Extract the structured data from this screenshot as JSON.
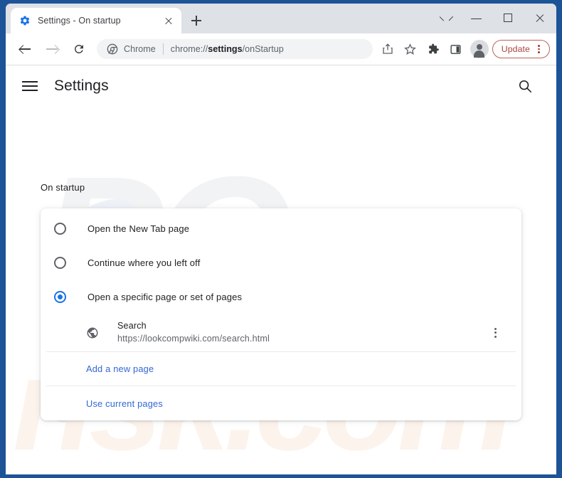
{
  "window": {
    "frame_color": "#1d5397",
    "controls": {
      "tab_search": "tab-search",
      "minimize": "minimize",
      "maximize": "maximize",
      "close": "close"
    }
  },
  "tabstrip": {
    "tabs": [
      {
        "title": "Settings - On startup",
        "favicon": "gear-icon",
        "active": true
      }
    ],
    "new_tab_label": "+"
  },
  "toolbar": {
    "back": "back",
    "forward": "forward",
    "reload": "reload",
    "omnibox": {
      "chip_icon": "chrome-logo-icon",
      "chip_label": "Chrome",
      "url_prefix": "chrome://",
      "url_bold": "settings",
      "url_suffix": "/onStartup",
      "url_full": "chrome://settings/onStartup"
    },
    "icons": [
      "share-icon",
      "bookmark-star-icon",
      "extensions-puzzle-icon",
      "side-panel-icon"
    ],
    "avatar": "profile-avatar",
    "update_label": "Update",
    "update_color": "#a8453c",
    "update_menu": "three-dot-menu"
  },
  "settings": {
    "header": {
      "menu_icon": "hamburger-icon",
      "title": "Settings",
      "search_icon": "search-icon"
    },
    "section_heading": "On startup",
    "options": [
      {
        "label": "Open the New Tab page",
        "selected": false
      },
      {
        "label": "Continue where you left off",
        "selected": false
      },
      {
        "label": "Open a specific page or set of pages",
        "selected": true
      }
    ],
    "startup_pages": [
      {
        "favicon": "globe-icon",
        "title": "Search",
        "url": "https://lookcompwiki.com/search.html",
        "menu": "three-dot-menu"
      }
    ],
    "links": [
      {
        "label": "Add a new page"
      },
      {
        "label": "Use current pages"
      }
    ],
    "accent_color": "#1a73e8",
    "link_color": "#3367d6"
  },
  "watermark": {
    "text_top": "PC",
    "text_bottom": "risk.com"
  }
}
